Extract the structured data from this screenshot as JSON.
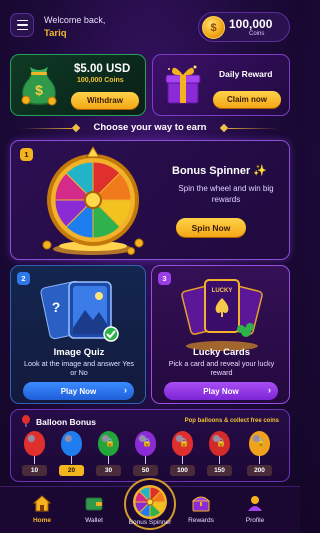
{
  "header": {
    "welcome": "Welcome back,",
    "username": "Tariq",
    "coins": "100,000",
    "coins_unit": "Coins"
  },
  "wallet_card": {
    "amount": "$5.00 USD",
    "coins": "100,000 Coins",
    "button": "Withdraw"
  },
  "daily_card": {
    "title": "Daily Reward",
    "button": "Claim now"
  },
  "section_title": "Choose your way to earn",
  "spinner_card": {
    "badge": "1",
    "title": "Bonus Spinner ✨",
    "subtitle": "Spin the wheel and win big rewards",
    "button": "Spin Now"
  },
  "quiz_card": {
    "badge": "2",
    "title": "Image Quiz",
    "subtitle": "Look at the image and answer Yes or No",
    "button": "Play Now",
    "arrow": "›"
  },
  "lucky_card": {
    "badge": "3",
    "title": "Lucky Cards",
    "subtitle": "Pick a card and reveal your lucky reward",
    "button": "Play Now",
    "arrow": "›",
    "card_text": "LUCKY"
  },
  "balloon_bonus": {
    "title": "Balloon Bonus",
    "subtitle": "Pop balloons & collect free coins",
    "balloons": [
      {
        "value": "10",
        "color": "#e0302e",
        "locked": false
      },
      {
        "value": "20",
        "color": "#1e7ef0",
        "locked": false,
        "active": true
      },
      {
        "value": "30",
        "color": "#22a63a",
        "locked": true
      },
      {
        "value": "50",
        "color": "#8a2bd6",
        "locked": true
      },
      {
        "value": "100",
        "color": "#e0302e",
        "locked": true
      },
      {
        "value": "150",
        "color": "#d42a2a",
        "locked": true
      },
      {
        "value": "200",
        "color": "#f0a21c",
        "locked": true
      }
    ]
  },
  "nav": {
    "home": "Home",
    "wallet": "Wallet",
    "spinner": "Bonus Spinner",
    "rewards": "Rewards",
    "profile": "Profile"
  },
  "colors": {
    "accent_gold": "#f5b82a",
    "green_border": "#27a157",
    "purple_border": "#8d4ed8",
    "blue_button": "#2f78e8",
    "purple_button": "#9a3ee8"
  }
}
